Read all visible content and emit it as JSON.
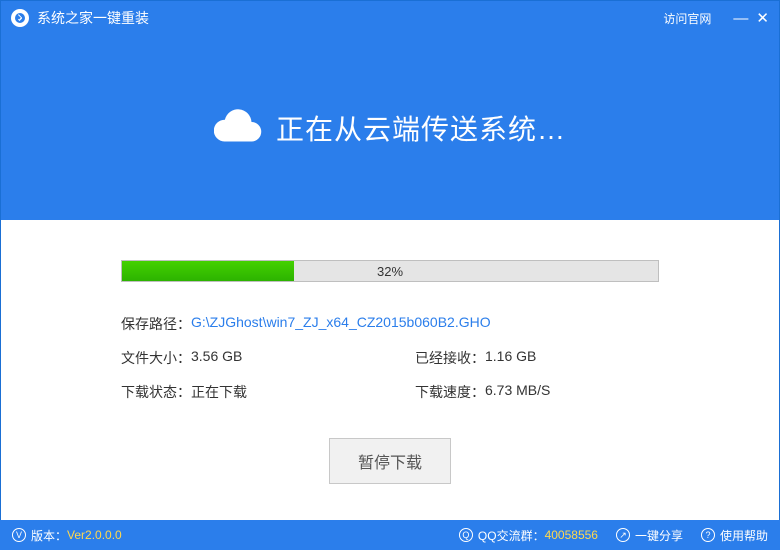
{
  "titlebar": {
    "title": "系统之家一键重装",
    "visit_site": "访问官网"
  },
  "header": {
    "heading": "正在从云端传送系统…"
  },
  "progress": {
    "percent": 32,
    "percent_text": "32%"
  },
  "info": {
    "save_path_label": "保存路径：",
    "save_path_value": "G:\\ZJGhost\\win7_ZJ_x64_CZ2015b060B2.GHO",
    "file_size_label": "文件大小：",
    "file_size_value": "3.56 GB",
    "received_label": "已经接收：",
    "received_value": "1.16 GB",
    "status_label": "下载状态：",
    "status_value": "正在下载",
    "speed_label": "下载速度：",
    "speed_value": "6.73 MB/S"
  },
  "buttons": {
    "pause": "暂停下载"
  },
  "footer": {
    "version_label": "版本：",
    "version_value": "Ver2.0.0.0",
    "qq_label": "QQ交流群：",
    "qq_value": "40058556",
    "share": "一键分享",
    "help": "使用帮助"
  }
}
